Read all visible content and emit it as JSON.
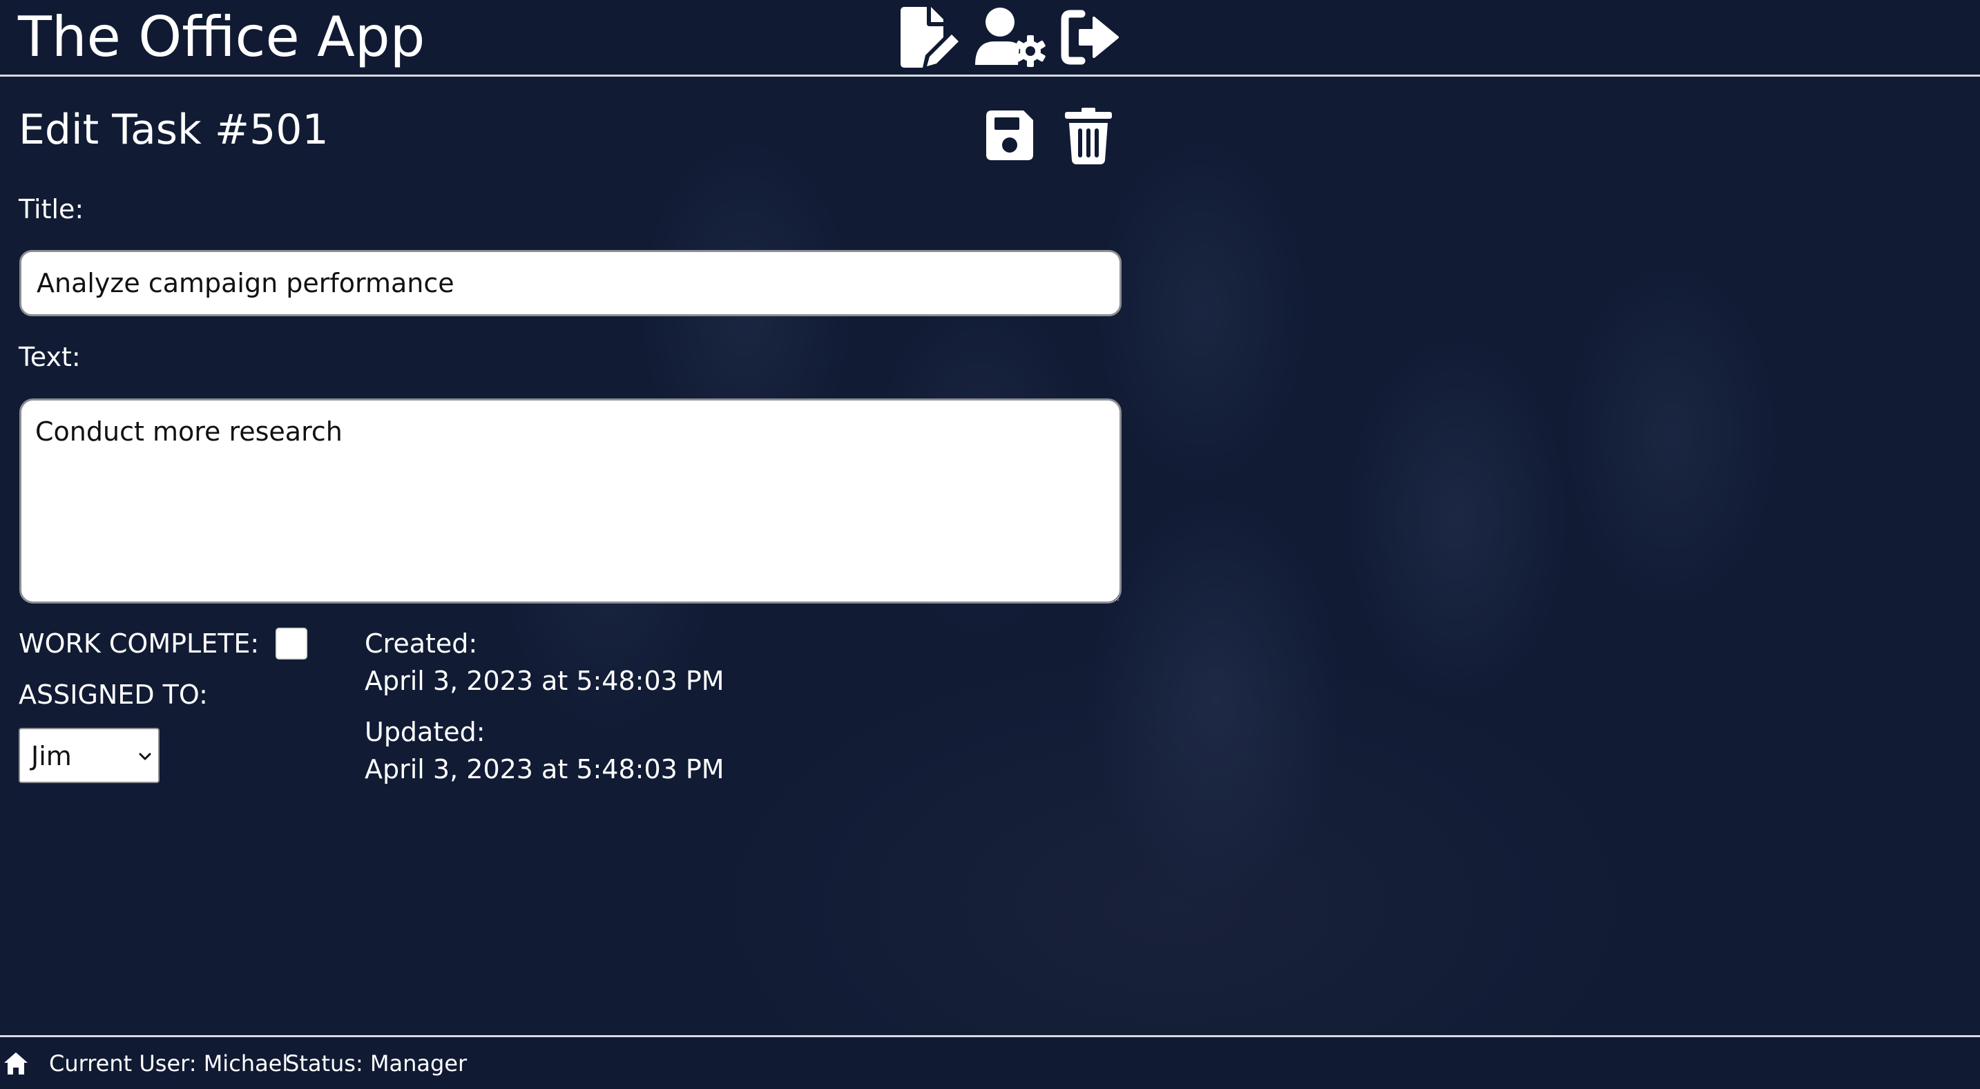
{
  "header": {
    "app_title": "The Office App",
    "icons": [
      "file-edit-icon",
      "user-settings-icon",
      "logout-icon"
    ]
  },
  "task": {
    "heading": "Edit Task #501",
    "title_label": "Title:",
    "title_value": "Analyze campaign performance",
    "text_label": "Text:",
    "text_value": "Conduct more research",
    "work_complete_label": "WORK COMPLETE:",
    "work_complete_checked": false,
    "assigned_to_label": "ASSIGNED TO:",
    "assigned_to_value": "Jim",
    "created_label": "Created:",
    "created_value": "April 3, 2023 at 5:48:03 PM",
    "updated_label": "Updated:",
    "updated_value": "April 3, 2023 at 5:48:03 PM",
    "action_icons": [
      "save-icon",
      "trash-icon"
    ]
  },
  "footer": {
    "current_user": "Current User: Michael",
    "status": "Status: Manager",
    "icon": "home-icon"
  },
  "colors": {
    "background": "#101a33",
    "divider": "#d8dbe2",
    "text": "#ffffff"
  }
}
